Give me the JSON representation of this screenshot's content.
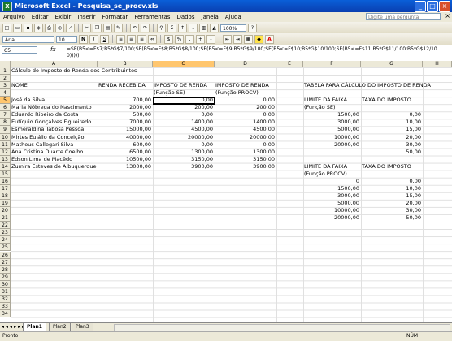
{
  "window": {
    "title": "Microsoft Excel - Pesquisa_se_procv.xls"
  },
  "menu": [
    "Arquivo",
    "Editar",
    "Exibir",
    "Inserir",
    "Formatar",
    "Ferramentas",
    "Dados",
    "Janela",
    "Ajuda"
  ],
  "help_placeholder": "Digite uma pergunta",
  "toolbar": {
    "zoom": "100%",
    "font": "Arial",
    "size": "10"
  },
  "formula_bar": {
    "name_box": "C5",
    "fx": "fx",
    "formula": "=SE(B5<=F$7;B5*G$7/100;SE(B5<=F$8;B5*G$8/100;SE(B5<=F$9;B5*G$9/100;SE(B5<=F$10;B5*G$10/100;SE(B5<=F$11;B5*G$11/100;B5*G$12/100)))))"
  },
  "columns": [
    "A",
    "B",
    "C",
    "D",
    "E",
    "F",
    "G",
    "H"
  ],
  "rows": [
    "1",
    "2",
    "3",
    "4",
    "5",
    "6",
    "7",
    "8",
    "9",
    "10",
    "11",
    "12",
    "13",
    "14",
    "15",
    "16",
    "17",
    "18",
    "19",
    "20",
    "21",
    "22",
    "23",
    "24",
    "25",
    "26",
    "27",
    "28",
    "29",
    "30",
    "31",
    "32",
    "33",
    "34"
  ],
  "sheet": {
    "title": "Cálculo do Imposto de Renda dos Contribuintes",
    "headers": {
      "nome": "NOME",
      "renda": "RENDA RECEBIDA",
      "imp_se": "IMPOSTO DE RENDA",
      "imp_se2": "(Função SE)",
      "imp_procv": "IMPOSTO DE RENDA",
      "imp_procv2": "(Função PROCV)",
      "tabela": "TABELA PARA CÁLCULO DO IMPOSTO DE RENDA"
    },
    "people": [
      {
        "nome": "José da Silva",
        "renda": "700,00",
        "se": "0,00",
        "procv": "0,00"
      },
      {
        "nome": "Maria Nóbrega do Nascimento",
        "renda": "2000,00",
        "se": "200,00",
        "procv": "200,00"
      },
      {
        "nome": "Eduardo Ribeiro da Costa",
        "renda": "500,00",
        "se": "0,00",
        "procv": "0,00"
      },
      {
        "nome": "Eutíquio Gonçalves Figueiredo",
        "renda": "7000,00",
        "se": "1400,00",
        "procv": "1400,00"
      },
      {
        "nome": "Esmeraldina Tabosa Pessoa",
        "renda": "15000,00",
        "se": "4500,00",
        "procv": "4500,00"
      },
      {
        "nome": "Mirtes Eulálio da Conceição",
        "renda": "40000,00",
        "se": "20000,00",
        "procv": "20000,00"
      },
      {
        "nome": "Matheus Callegari Silva",
        "renda": "600,00",
        "se": "0,00",
        "procv": "0,00"
      },
      {
        "nome": "Ana Cristina Duarte Coelho",
        "renda": "6500,00",
        "se": "1300,00",
        "procv": "1300,00"
      },
      {
        "nome": "Edson Lima de Macêdo",
        "renda": "10500,00",
        "se": "3150,00",
        "procv": "3150,00"
      },
      {
        "nome": "Zumira Esteves de Albuquerque",
        "renda": "13000,00",
        "se": "3900,00",
        "procv": "3900,00"
      }
    ],
    "table_se": {
      "limite": "LIMITE DA FAIXA",
      "limite2": "(Função SE)",
      "taxa": "TAXA DO IMPOSTO",
      "rows": [
        [
          "1500,00",
          "0,00"
        ],
        [
          "3000,00",
          "10,00"
        ],
        [
          "5000,00",
          "15,00"
        ],
        [
          "10000,00",
          "20,00"
        ],
        [
          "20000,00",
          "30,00"
        ],
        [
          "",
          "50,00"
        ]
      ]
    },
    "table_procv": {
      "limite": "LIMITE DA FAIXA",
      "limite2": "(Função PROCV)",
      "taxa": "TAXA DO IMPOSTO",
      "rows": [
        [
          "0",
          "0,00"
        ],
        [
          "1500,00",
          "10,00"
        ],
        [
          "3000,00",
          "15,00"
        ],
        [
          "5000,00",
          "20,00"
        ],
        [
          "10000,00",
          "30,00"
        ],
        [
          "20000,00",
          "50,00"
        ]
      ]
    }
  },
  "tabs": [
    "Plan1",
    "Plan2",
    "Plan3"
  ],
  "status": {
    "left": "Pronto",
    "right": "NÚM"
  }
}
